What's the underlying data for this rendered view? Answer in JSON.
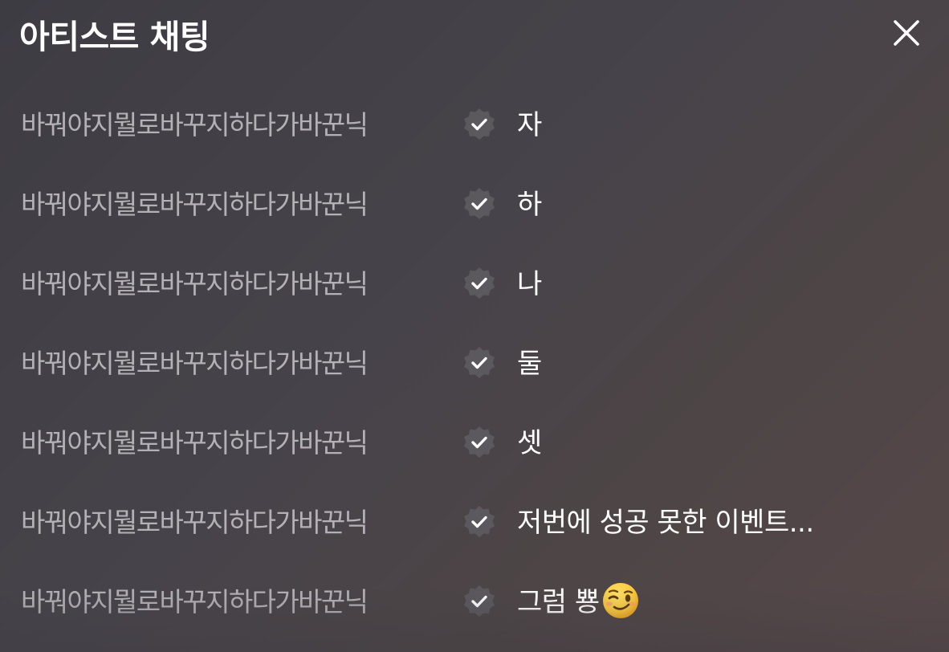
{
  "header": {
    "title": "아티스트 채팅",
    "close_icon": "close-icon"
  },
  "messages": [
    {
      "sender": "바꿔야지뭘로바꾸지하다가바꾼닉",
      "badge": "verified-badge-icon",
      "text": "자"
    },
    {
      "sender": "바꿔야지뭘로바꾸지하다가바꾼닉",
      "badge": "verified-badge-icon",
      "text": "하"
    },
    {
      "sender": "바꿔야지뭘로바꾸지하다가바꾼닉",
      "badge": "verified-badge-icon",
      "text": "나"
    },
    {
      "sender": "바꿔야지뭘로바꾸지하다가바꾼닉",
      "badge": "verified-badge-icon",
      "text": "둘"
    },
    {
      "sender": "바꿔야지뭘로바꾸지하다가바꾼닉",
      "badge": "verified-badge-icon",
      "text": "셋"
    },
    {
      "sender": "바꿔야지뭘로바꾸지하다가바꾼닉",
      "badge": "verified-badge-icon",
      "text": "저번에 성공 못한 이벤트..."
    },
    {
      "sender": "바꿔야지뭘로바꾸지하다가바꾼닉",
      "badge": "verified-badge-icon",
      "text": "그럼 뿅",
      "emoji": "winking-face-emoji"
    }
  ],
  "colors": {
    "background": "#46434a",
    "sender": "#b4b1b6",
    "message": "#ffffff",
    "badge": "#5b585e"
  }
}
